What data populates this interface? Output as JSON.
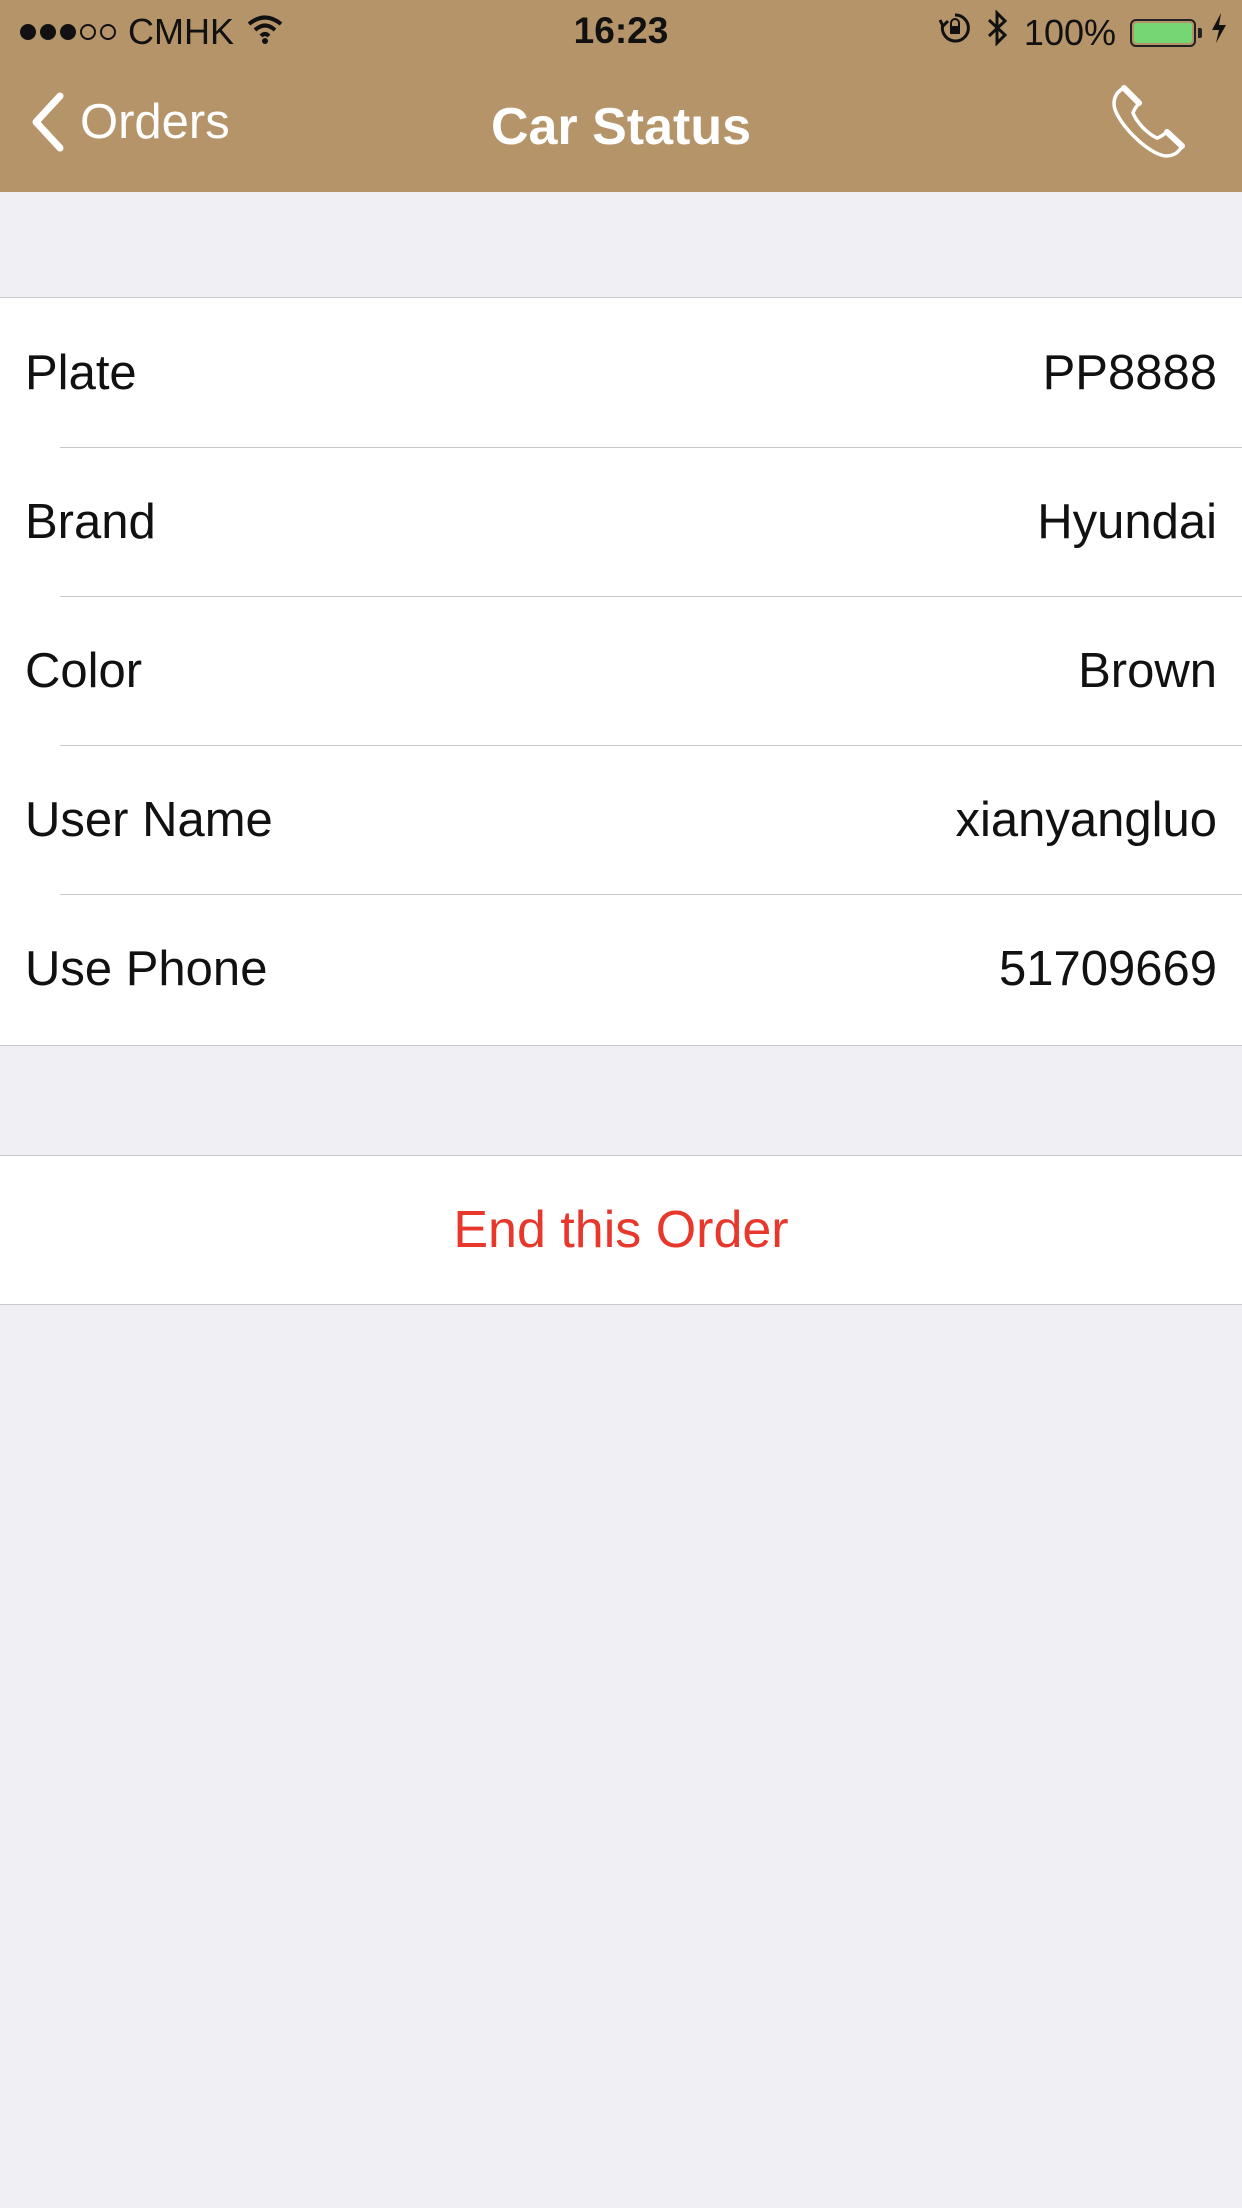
{
  "status_bar": {
    "carrier": "CMHK",
    "time": "16:23",
    "battery": "100%",
    "signal_strength": 3,
    "signal_total": 5,
    "icons": [
      "wifi-icon",
      "orientation-lock-icon",
      "bluetooth-icon",
      "battery-icon",
      "charging-icon"
    ]
  },
  "navbar": {
    "back_label": "Orders",
    "title": "Car Status",
    "right_icon": "phone-icon",
    "background_color": "#b5946a"
  },
  "details": [
    {
      "label": "Plate",
      "value": "PP8888"
    },
    {
      "label": "Brand",
      "value": "Hyundai"
    },
    {
      "label": "Color",
      "value": "Brown"
    },
    {
      "label": "User Name",
      "value": "xianyangluo"
    },
    {
      "label": "Use Phone",
      "value": "51709669"
    }
  ],
  "actions": {
    "end_order_label": "End this Order",
    "end_order_color": "#e8372b"
  }
}
